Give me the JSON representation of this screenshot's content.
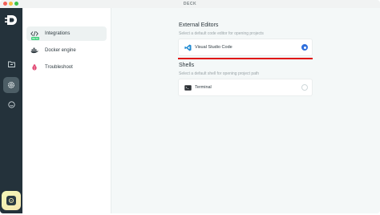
{
  "window": {
    "title": "DECK"
  },
  "rail": {
    "items": [
      {
        "icon": "logo-icon"
      },
      {
        "icon": "folder-icon"
      },
      {
        "icon": "gear-icon",
        "active": true
      },
      {
        "icon": "smile-icon"
      }
    ],
    "bottom_icon": "user-icon"
  },
  "nav": {
    "items": [
      {
        "label": "Integrations",
        "icon": "code-icon",
        "badge": "BETA",
        "active": true
      },
      {
        "label": "Docker engine",
        "icon": "docker-icon"
      },
      {
        "label": "Troubleshoot",
        "icon": "bug-icon"
      }
    ]
  },
  "main": {
    "editors": {
      "title": "External Editors",
      "description": "Select a default code editor for opening projects",
      "options": [
        {
          "label": "Visual Studio Code",
          "icon": "vscode-icon",
          "selected": true
        }
      ]
    },
    "shells": {
      "title": "Shells",
      "description": "Select a default shell for opening project path",
      "options": [
        {
          "label": "Terminal",
          "icon": "terminal-icon",
          "selected": false
        }
      ]
    }
  },
  "colors": {
    "rail_bg": "#24323b",
    "accent": "#2f6fdc",
    "highlight": "#e01010",
    "beta": "#3fcf7c"
  }
}
